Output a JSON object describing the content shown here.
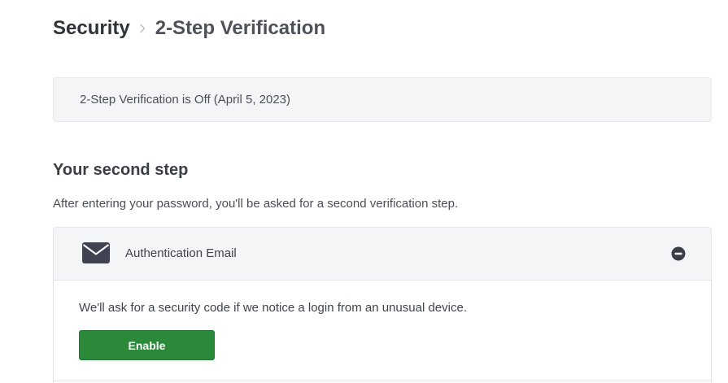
{
  "breadcrumb": {
    "root": "Security",
    "current": "2-Step Verification"
  },
  "status": {
    "text": "2-Step Verification is Off (April 5, 2023)"
  },
  "second_step": {
    "title": "Your second step",
    "description": "After entering your password, you'll be asked for a second verification step."
  },
  "method": {
    "icon": "envelope-icon",
    "title": "Authentication Email",
    "collapse_icon": "minus-circle-icon",
    "body_text": "We'll ask for a security code if we notice a login from an unusual device.",
    "enable_label": "Enable"
  },
  "colors": {
    "accent_green": "#2a8a3a",
    "panel_bg": "#f4f5f7",
    "icon_dark": "#3e4251"
  }
}
